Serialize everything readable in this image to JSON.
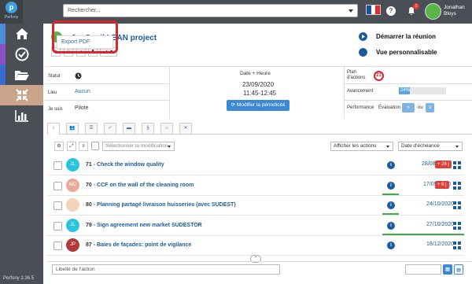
{
  "app": {
    "brand": "Perfony",
    "version": "Perfony 2.36.5"
  },
  "topbar": {
    "search_placeholder": "Rechercher...",
    "notif_count": "1",
    "user_name_line1": "Jonathan",
    "user_name_line2": "Bloys"
  },
  "project": {
    "number": "9",
    "sep": "-",
    "title": "Copil LEAN project"
  },
  "actions": {
    "start_meeting": "Démarrer la réunion",
    "custom_view": "Vue personnalisable"
  },
  "dropdown": {
    "export_pdf": "Export PDF"
  },
  "info": {
    "statut_label": "Statut",
    "lieu_label": "Lieu",
    "lieu_value": "Aucun",
    "je_suis_label": "Je suis",
    "je_suis_value": "Pilote",
    "date_heure_label": "Date + Heure",
    "date_value": "23/09/2020",
    "time_value": "11:45-12:45",
    "modify_btn": "Modifier la périodicité",
    "plan_label_1": "Plan",
    "plan_label_2": "d'actions",
    "plan_count": "21",
    "avancement_label": "Avancement",
    "avancement_value": "24%",
    "avancement_fraction": 0.24,
    "performance_label": "Performance",
    "evaluation_label": "Évaluation :",
    "ou_label": "ou"
  },
  "toolbar": {
    "select_modif": "Sélectionner la modification",
    "filter_actions": "Afficher les actions",
    "sort_by": "Date d'échéance"
  },
  "rows": [
    {
      "num": "71",
      "title": "Check the window quality",
      "date": "28/08/2020",
      "badge": "+ 26 j",
      "initials": "JL",
      "avatar_color": "#2bc4e0",
      "bar_fraction": 0
    },
    {
      "num": "70",
      "title": "CCF on the wall of the cleaning room",
      "date": "17/09/2020",
      "badge": "+ 6 j",
      "initials": "MD",
      "avatar_color": "#e8a89a",
      "bar_fraction": 0.2
    },
    {
      "num": "80",
      "title": "Planning partagé livraison huisseries (avec SUDEST)",
      "date": "24/10/2020",
      "badge": "",
      "initials": "",
      "avatar_color": "#f2d4b8",
      "bar_fraction": 0.2
    },
    {
      "num": "79",
      "title": "Sign agreement new market SUDESTOR",
      "date": "27/10/2020",
      "badge": "",
      "initials": "JL",
      "avatar_color": "#2bc4e0",
      "bar_fraction": 1.0
    },
    {
      "num": "87",
      "title": "Baies de façades: point de vigilance",
      "date": "18/12/2020",
      "badge": "",
      "initials": "JP",
      "avatar_color": "#b03a3a",
      "bar_fraction": 0
    }
  ],
  "bottom": {
    "action_placeholder": "Libellé de l'action"
  },
  "colors": {
    "accent": "#1a5b9c",
    "danger": "#d8262e",
    "success": "#3fae49"
  }
}
